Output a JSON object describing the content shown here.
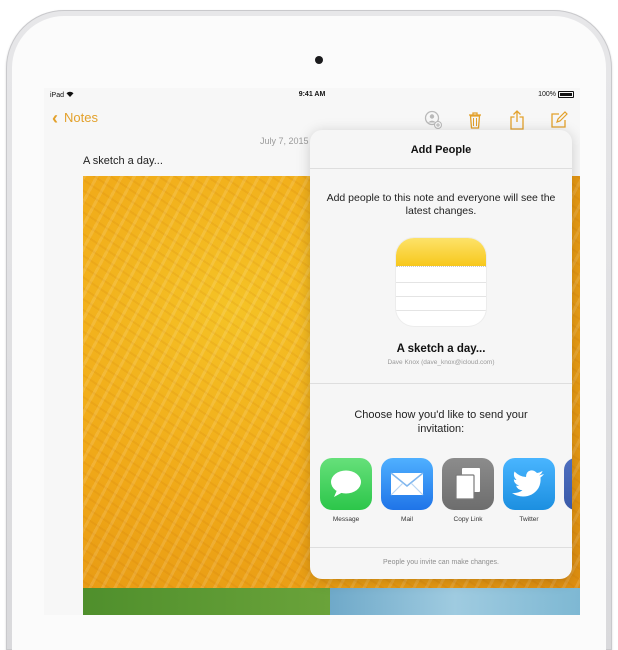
{
  "status_bar": {
    "carrier": "iPad",
    "time": "9:41 AM",
    "battery": "100%"
  },
  "navbar": {
    "back_label": "Notes",
    "accent_color": "#e3a12b",
    "icons": [
      "add-people-icon",
      "trash-icon",
      "share-icon",
      "compose-icon"
    ]
  },
  "note": {
    "date": "July 7, 2015",
    "title": "A sketch a day..."
  },
  "popover": {
    "title": "Add People",
    "description": "Add people to this note and everyone will see the latest changes.",
    "note_title": "A sketch a day...",
    "note_owner": "Dave Knox (dave_knox@icloud.com)",
    "choose_text": "Choose how you'd like to send your invitation:",
    "apps": [
      {
        "label": "Message",
        "icon": "message-icon",
        "color": "#3fd05a"
      },
      {
        "label": "Mail",
        "icon": "mail-icon",
        "color": "#2f8ff0"
      },
      {
        "label": "Copy Link",
        "icon": "copy-link-icon",
        "color": "#7c7c7c"
      },
      {
        "label": "Twitter",
        "icon": "twitter-icon",
        "color": "#2aa4f0"
      }
    ],
    "footer": "People you invite can make changes."
  }
}
